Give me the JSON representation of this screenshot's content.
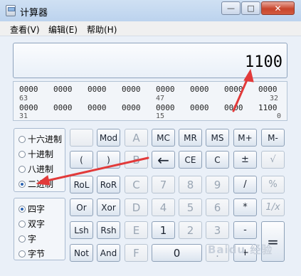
{
  "window": {
    "title": "计算器",
    "minimize_glyph": "—",
    "maximize_glyph": "□",
    "close_glyph": "✕"
  },
  "menu": {
    "items": [
      "查看(V)",
      "编辑(E)",
      "帮助(H)"
    ]
  },
  "display": {
    "value": "1100"
  },
  "bits": {
    "row1": [
      "0000",
      "0000",
      "0000",
      "0000",
      "0000",
      "0000",
      "0000",
      "0000"
    ],
    "row1_positions": [
      "63",
      "47",
      "32"
    ],
    "row2": [
      "0000",
      "0000",
      "0000",
      "0000",
      "0000",
      "0000",
      "0000",
      "1100"
    ],
    "row2_positions": [
      "31",
      "15",
      "0"
    ]
  },
  "base_options": [
    "十六进制",
    "十进制",
    "八进制",
    "二进制"
  ],
  "base_selected": "二进制",
  "word_options": [
    "四字",
    "双字",
    "字",
    "字节"
  ],
  "word_selected": "四字",
  "keys": [
    [
      "",
      "Mod",
      "A",
      "MC",
      "MR",
      "MS",
      "M+",
      "M-"
    ],
    [
      "(",
      ")",
      "B",
      "←",
      "CE",
      "C",
      "±",
      "√"
    ],
    [
      "RoL",
      "RoR",
      "C",
      "7",
      "8",
      "9",
      "/",
      "%"
    ],
    [
      "Or",
      "Xor",
      "D",
      "4",
      "5",
      "6",
      "*",
      "1/x"
    ],
    [
      "Lsh",
      "Rsh",
      "E",
      "1",
      "2",
      "3",
      "-",
      "="
    ],
    [
      "Not",
      "And",
      "F",
      "0",
      ".",
      "+"
    ]
  ],
  "watermark": "Baidu 经验",
  "colors": {
    "arrow": "#e23a3a",
    "title_bar": "#c6daf2",
    "close_button": "#c8452c"
  }
}
